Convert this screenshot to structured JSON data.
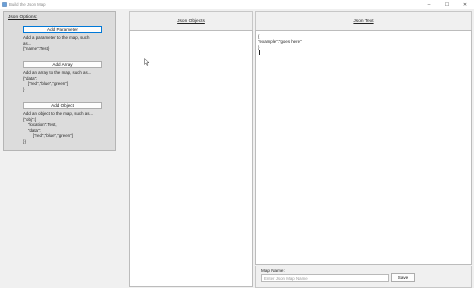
{
  "window": {
    "title": "Build the Json Map",
    "controls": [
      "–",
      "☐",
      "✕"
    ]
  },
  "options": {
    "title": "Json Options:",
    "add_parameter_label": "Add Parameter",
    "add_parameter_desc": "Add a parameter to the map, such\nas...\n{\"name\":Test}",
    "add_array_label": "Add Array",
    "add_array_desc": "Add an array to the map, such as...\n{\"data\":\n    [\"red\",\"blue\",\"green\"]\n}",
    "add_object_label": "Add Object",
    "add_object_desc": "Add an object to the map, such as...\n{\"obj\":{\n    \"location\":Test,\n    \"data\":\n        [\"red\",\"blue\",\"green\"]\n}}"
  },
  "columns": {
    "objects_header": "Json Objects",
    "text_header": "Json Text"
  },
  "json_text": "{\n\"example\":\"goes here\"\n}",
  "map": {
    "label": "Map Name:",
    "placeholder": "Enter Json Map Name",
    "value": "",
    "save_label": "Save"
  }
}
